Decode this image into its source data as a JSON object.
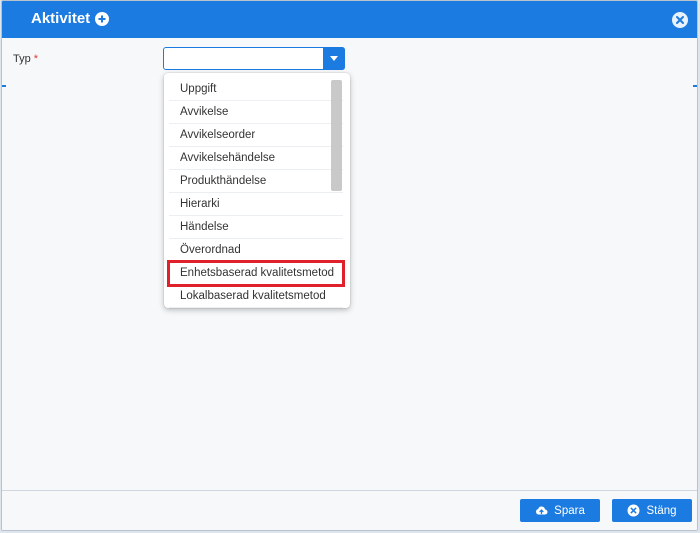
{
  "dialog": {
    "title": "Aktivitet"
  },
  "form": {
    "type_label": "Typ",
    "required_marker": "*",
    "type_value": ""
  },
  "dropdown": {
    "options": [
      "Uppgift",
      "Avvikelse",
      "Avvikelseorder",
      "Avvikelsehändelse",
      "Produkthändelse",
      "Hierarki",
      "Händelse",
      "Överordnad",
      "Enhetsbaserad kvalitetsmetod",
      "Lokalbaserad kvalitetsmetod"
    ],
    "highlighted_option": "Enhetsbaserad kvalitetsmetod"
  },
  "footer": {
    "save_label": "Spara",
    "close_label": "Stäng"
  },
  "colors": {
    "primary": "#1c7be0",
    "highlight": "#e0202b",
    "required": "#e53935"
  },
  "icons": {
    "title": "plus-circle-icon",
    "close": "close-circle-icon",
    "dropdown": "caret-down-icon",
    "save": "cloud-upload-icon",
    "close_button": "x-circle-icon"
  }
}
